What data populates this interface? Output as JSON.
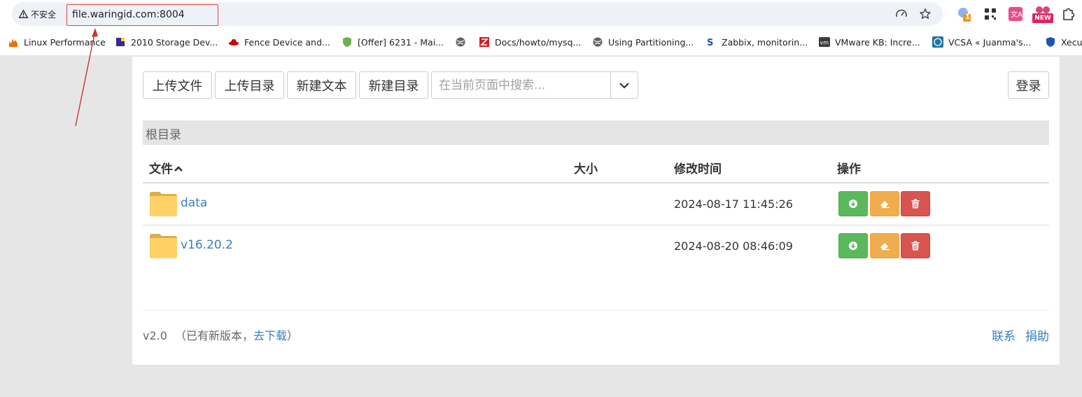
{
  "browser": {
    "security_label": "不安全",
    "url": "file.waringid.com:8004",
    "extension_badge": "1",
    "new_badge": "NEW",
    "bookmarks": [
      {
        "label": "Linux Performance",
        "icon": "flame-icon"
      },
      {
        "label": "2010 Storage Dev...",
        "icon": "storage-icon"
      },
      {
        "label": "Fence Device and...",
        "icon": "redhat-icon"
      },
      {
        "label": "[Offer] 6231 - Mai...",
        "icon": "shield-icon"
      },
      {
        "label": "",
        "icon": "globe-icon"
      },
      {
        "label": "Docs/howto/mysq...",
        "icon": "zimbra-icon"
      },
      {
        "label": "Using Partitioning...",
        "icon": "globe-icon"
      },
      {
        "label": "Zabbix, monitorin...",
        "icon": "zabbix-icon"
      },
      {
        "label": "VMware KB: Incre...",
        "icon": "vmware-icon"
      },
      {
        "label": "VCSA « Juanma's...",
        "icon": "wordpress-icon"
      },
      {
        "label": "Xecu",
        "icon": "shield-icon"
      }
    ]
  },
  "toolbar": {
    "upload_file": "上传文件",
    "upload_dir": "上传目录",
    "new_text": "新建文本",
    "new_dir": "新建目录",
    "search_placeholder": "在当前页面中搜索...",
    "login": "登录"
  },
  "breadcrumb": "根目录",
  "table": {
    "headers": {
      "name": "文件",
      "size": "大小",
      "mtime": "修改时间",
      "actions": "操作"
    },
    "sort_indicator": "up",
    "rows": [
      {
        "name": "data",
        "size": "",
        "mtime": "2024-08-17 11:45:26"
      },
      {
        "name": "v16.20.2",
        "size": "",
        "mtime": "2024-08-20 08:46:09"
      }
    ]
  },
  "footer": {
    "version": "v2.0",
    "update_prefix": "（已有新版本，",
    "update_link": "去下载",
    "update_suffix": "）",
    "contact": "联系",
    "donate": "捐助"
  },
  "colors": {
    "link": "#3a7dbf",
    "download": "#5cb85c",
    "edit": "#f0ad4e",
    "delete": "#d9534f",
    "annotation": "#c0392b"
  }
}
